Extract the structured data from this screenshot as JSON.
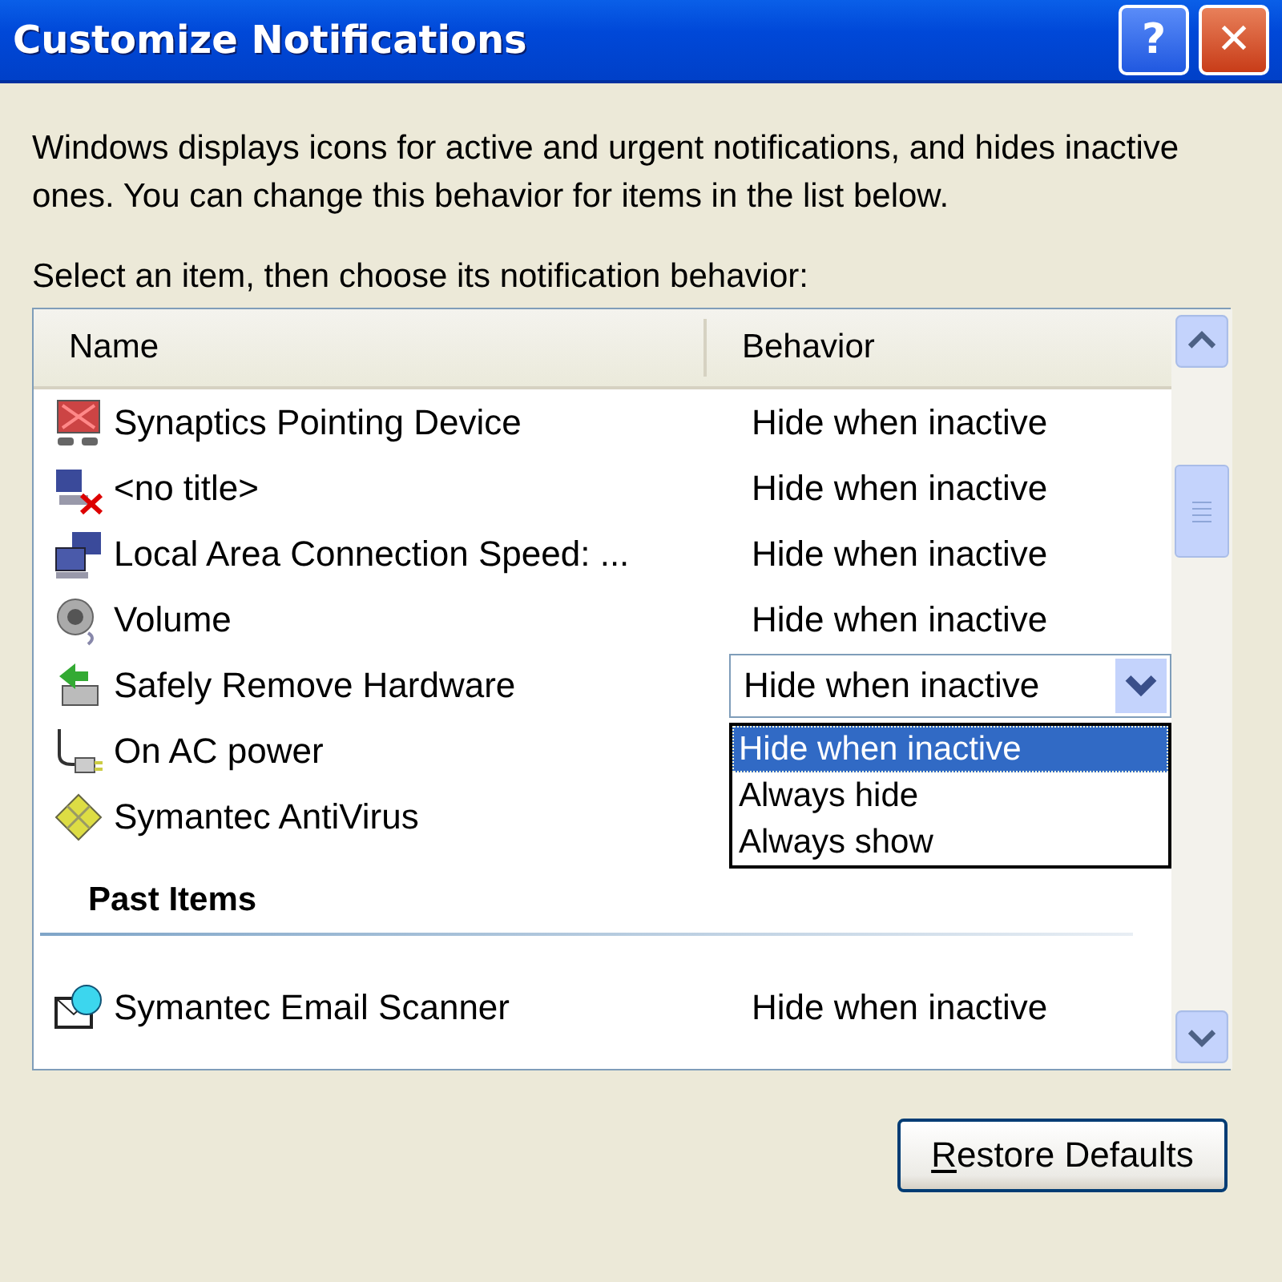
{
  "window": {
    "title": "Customize Notifications",
    "buttons": [
      {
        "kind": "help",
        "label": "?"
      },
      {
        "kind": "close",
        "label": "✕"
      }
    ]
  },
  "intro": "Windows displays icons for active and urgent notifications, and hides inactive ones. You can change this behavior for items in the list below.",
  "list_label": "Select an item, then choose its notification behavior:",
  "table": {
    "columns": [
      "Name",
      "Behavior"
    ],
    "rows": [
      {
        "name": "Synaptics Pointing Device",
        "behavior": "Hide when inactive"
      },
      {
        "name": "<no title>",
        "behavior": "Hide when inactive"
      },
      {
        "name": "Local Area Connection Speed: ...",
        "behavior": "Hide when inactive"
      },
      {
        "name": "Volume",
        "behavior": "Hide when inactive"
      },
      {
        "name": "Safely Remove Hardware",
        "behavior": "Hide when inactive",
        "editing": true,
        "options": [
          {
            "label": "Hide when inactive",
            "selected": true
          },
          {
            "label": "Always hide",
            "selected": false
          },
          {
            "label": "Always show",
            "selected": false
          }
        ]
      },
      {
        "name": "On AC power"
      },
      {
        "name": "Symantec AntiVirus"
      }
    ],
    "past_heading": "Past Items",
    "past_rows": [
      {
        "name": "Symantec Email Scanner",
        "behavior": "Hide when inactive"
      }
    ]
  },
  "restore_button": {
    "label": "Restore Defaults",
    "underline_first": true
  }
}
